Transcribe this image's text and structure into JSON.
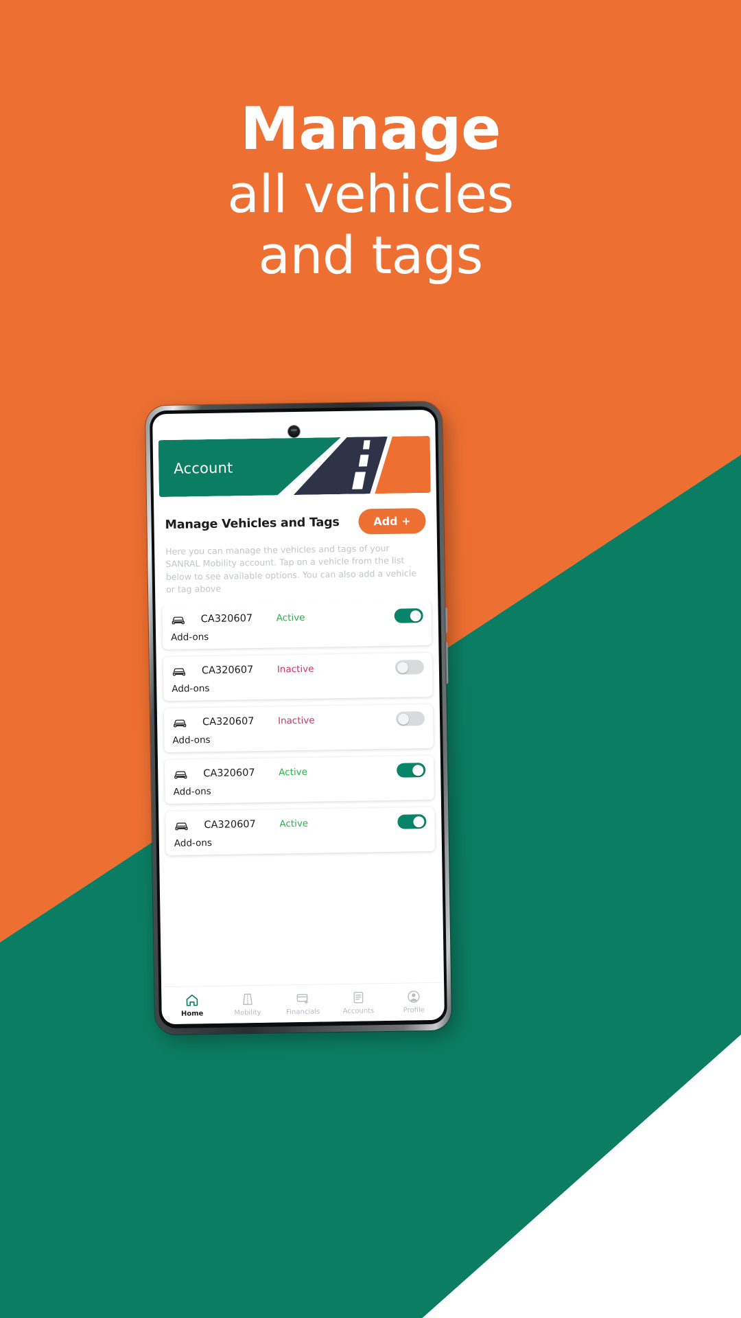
{
  "promo": {
    "headline_line1": "Manage",
    "headline_line2": "all vehicles",
    "headline_line3": "and tags",
    "bg_orange": "#ed6f31",
    "bg_green": "#0b7d62",
    "bg_white": "#ffffff",
    "headline_color": "#ffffff"
  },
  "app": {
    "header": {
      "title": "Account",
      "banner_green": "#0b7d62",
      "banner_orange": "#ed6f31",
      "banner_road": "#2f3347"
    },
    "section": {
      "title": "Manage Vehicles and Tags",
      "add_label": "Add +",
      "add_color": "#ed6f31",
      "description": "Here you can manage the vehicles and tags of your SANRAL Mobility account. Tap on a vehicle from the list below to see available options. You can also add a vehicle or tag above"
    },
    "vehicles": [
      {
        "icon": "car-icon",
        "plate": "CA320607",
        "status": "Active",
        "status_color": "#27b34b",
        "toggle": "on",
        "addons_label": "Add-ons"
      },
      {
        "icon": "car-icon",
        "plate": "CA320607",
        "status": "Inactive",
        "status_color": "#cc3360",
        "toggle": "off",
        "addons_label": "Add-ons"
      },
      {
        "icon": "car-icon",
        "plate": "CA320607",
        "status": "Inactive",
        "status_color": "#cc3360",
        "toggle": "off",
        "addons_label": "Add-ons"
      },
      {
        "icon": "car-icon",
        "plate": "CA320607",
        "status": "Active",
        "status_color": "#27b34b",
        "toggle": "on",
        "addons_label": "Add-ons"
      },
      {
        "icon": "car-icon",
        "plate": "CA320607",
        "status": "Active",
        "status_color": "#27b34b",
        "toggle": "on",
        "addons_label": "Add-ons"
      }
    ],
    "bottom_nav": {
      "active_color": "#0b7d62",
      "inactive_color": "#b9bcbf",
      "items": [
        {
          "label": "Home",
          "icon": "home-icon",
          "active": true
        },
        {
          "label": "Mobility",
          "icon": "road-icon",
          "active": false
        },
        {
          "label": "Financials",
          "icon": "card-plus-icon",
          "active": false
        },
        {
          "label": "Accounts",
          "icon": "document-icon",
          "active": false
        },
        {
          "label": "Profile",
          "icon": "person-icon",
          "active": false
        }
      ]
    }
  }
}
